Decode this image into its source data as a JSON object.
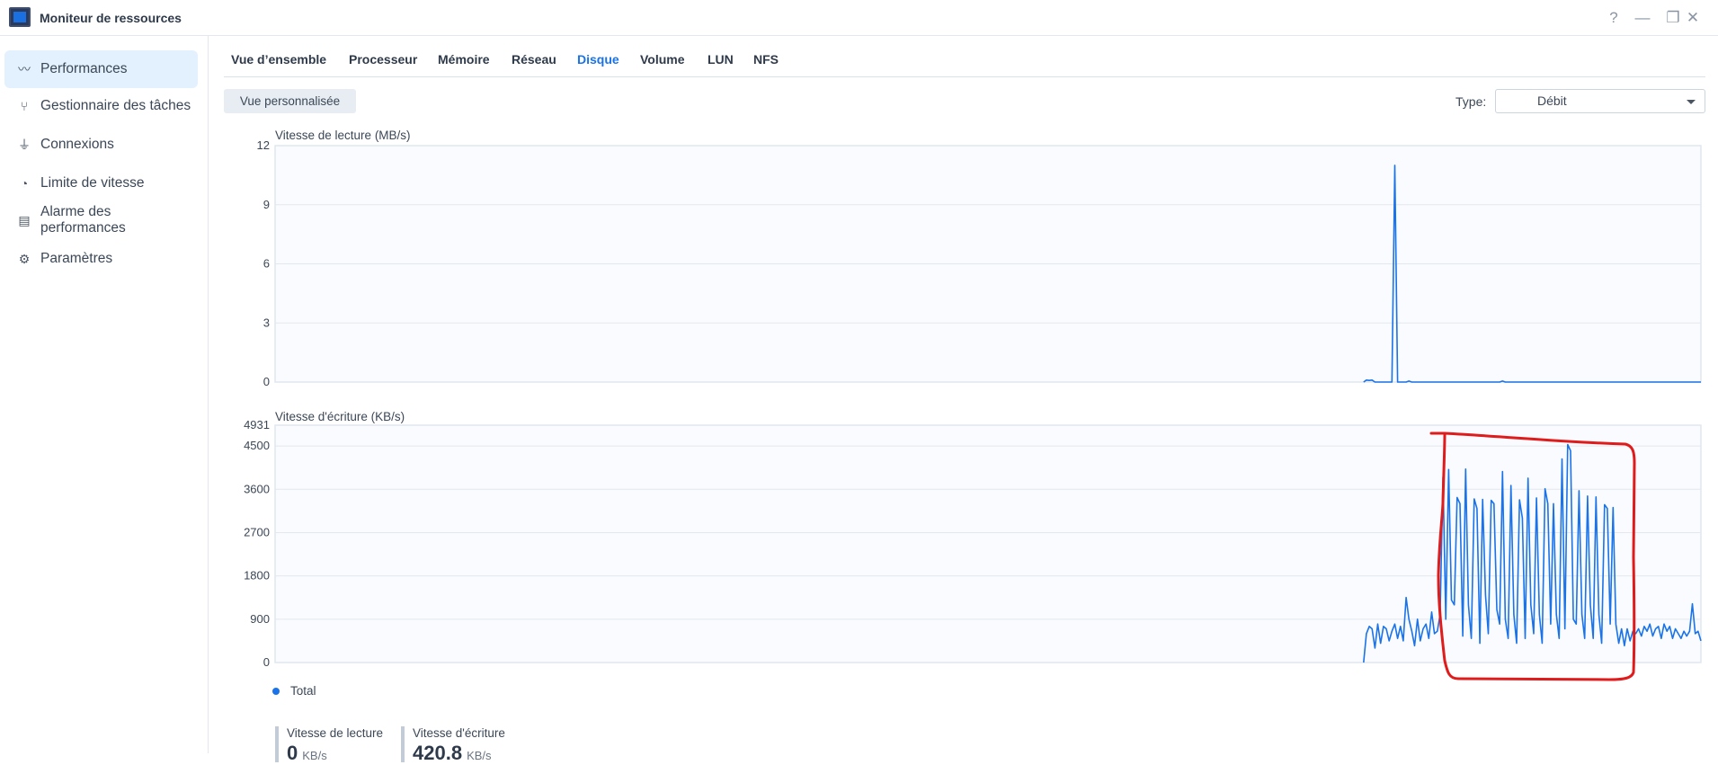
{
  "window": {
    "title": "Moniteur de ressources",
    "controls": [
      "?",
      "—",
      "❐",
      "✕"
    ]
  },
  "sidebar": {
    "items": [
      {
        "label": "Performances",
        "icon": "performance-icon",
        "active": true
      },
      {
        "label": "Gestionnaire des tâches",
        "icon": "task-manager-icon"
      },
      {
        "label": "Connexions",
        "icon": "plug-icon"
      },
      {
        "label": "Limite de vitesse",
        "icon": "speedometer-icon"
      },
      {
        "label": "Alarme des performances",
        "icon": "alarm-document-icon"
      },
      {
        "label": "Paramètres",
        "icon": "gear-icon"
      }
    ]
  },
  "tabs": [
    "Vue d’ensemble",
    "Processeur",
    "Mémoire",
    "Réseau",
    "Disque",
    "Volume",
    "LUN",
    "NFS"
  ],
  "active_tab": "Disque",
  "toolbar": {
    "custom_view_label": "Vue personnalisée",
    "type_label": "Type:",
    "type_value": "Débit"
  },
  "accent_color": "#1a73e8",
  "legend": {
    "label": "Total"
  },
  "stats": {
    "read": {
      "label": "Vitesse de lecture",
      "value": "0",
      "unit": "KB/s"
    },
    "write": {
      "label": "Vitesse d'écriture",
      "value": "420.8",
      "unit": "KB/s"
    }
  },
  "chart_data": [
    {
      "type": "line",
      "title": "Vitesse de lecture (MB/s)",
      "ylim": [
        0,
        12
      ],
      "yticks": [
        "0",
        "3",
        "6",
        "9",
        "12"
      ],
      "x_range": [
        0,
        503
      ],
      "x_start": 384,
      "series": [
        {
          "name": "Total",
          "values": [
            0,
            0.1,
            0.08,
            0.1,
            0,
            0,
            0,
            0,
            0,
            0,
            0,
            11,
            0,
            0,
            0,
            0,
            0.05,
            0,
            0,
            0,
            0,
            0,
            0,
            0,
            0,
            0,
            0,
            0,
            0,
            0,
            0,
            0,
            0,
            0,
            0,
            0,
            0,
            0,
            0,
            0,
            0,
            0,
            0,
            0,
            0,
            0,
            0,
            0,
            0,
            0.05,
            0,
            0,
            0,
            0,
            0,
            0,
            0,
            0,
            0,
            0,
            0,
            0,
            0,
            0,
            0,
            0,
            0,
            0,
            0,
            0,
            0,
            0,
            0,
            0,
            0,
            0,
            0,
            0,
            0,
            0,
            0,
            0,
            0,
            0,
            0,
            0,
            0,
            0,
            0,
            0,
            0,
            0,
            0,
            0,
            0,
            0,
            0,
            0,
            0,
            0,
            0,
            0,
            0,
            0,
            0,
            0,
            0,
            0,
            0,
            0,
            0,
            0,
            0,
            0,
            0,
            0,
            0,
            0,
            0,
            0
          ]
        }
      ],
      "grid": true
    },
    {
      "type": "line",
      "title": "Vitesse d'écriture (KB/s)",
      "ylim": [
        0,
        4931
      ],
      "yticks": [
        "0",
        "900",
        "1800",
        "2700",
        "3600",
        "4500",
        "4931"
      ],
      "x_range": [
        0,
        503
      ],
      "x_start": 384,
      "series": [
        {
          "name": "Total",
          "values": [
            0,
            600,
            750,
            700,
            300,
            800,
            400,
            750,
            700,
            450,
            650,
            800,
            500,
            750,
            450,
            1350,
            900,
            650,
            350,
            900,
            450,
            700,
            800,
            500,
            1050,
            600,
            650,
            1000,
            3850,
            900,
            4010,
            1300,
            1200,
            3430,
            3300,
            550,
            4020,
            1200,
            500,
            3400,
            3200,
            400,
            3390,
            1400,
            600,
            3370,
            3300,
            1100,
            800,
            3970,
            900,
            500,
            3680,
            1000,
            400,
            3380,
            3000,
            500,
            3830,
            1200,
            600,
            3420,
            1000,
            400,
            3610,
            3300,
            800,
            3300,
            1000,
            500,
            4230,
            700,
            4530,
            4400,
            900,
            800,
            3570,
            1000,
            500,
            3460,
            1200,
            500,
            3440,
            1000,
            400,
            3280,
            3200,
            800,
            3220,
            800,
            400,
            700,
            350,
            700,
            450,
            650,
            600,
            700,
            550,
            750,
            650,
            800,
            550,
            700,
            750,
            500,
            800,
            650,
            750,
            500,
            700,
            600,
            500,
            650,
            550,
            650,
            1220,
            600,
            650,
            450
          ]
        }
      ],
      "grid": true
    }
  ]
}
